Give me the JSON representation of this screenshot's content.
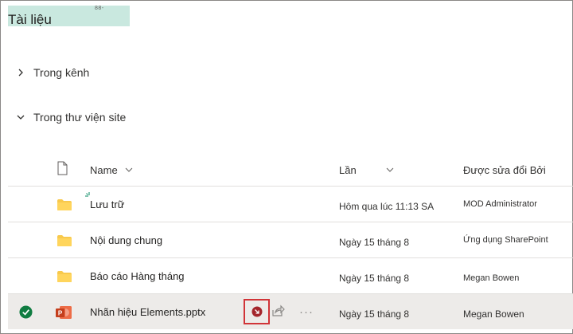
{
  "header": {
    "title": "Tài liệu",
    "badge": "88-"
  },
  "sections": [
    {
      "label": "Trong kênh",
      "expanded": false
    },
    {
      "label": "Trong thư viện site",
      "expanded": true
    }
  ],
  "columns": {
    "name": "Name",
    "modified": "Lần",
    "modified_by": "Được sửa đổi Bởi"
  },
  "rows": [
    {
      "type": "folder",
      "name": "Lưu trữ",
      "modified": "Hôm qua lúc 11:13 SA",
      "modified_by": "MOD Administrator",
      "icon": "folder-icon"
    },
    {
      "type": "folder",
      "name": "Nội dung chung",
      "modified": "Ngày 15 tháng 8",
      "modified_by": "Ứng dụng SharePoint",
      "icon": "folder-icon"
    },
    {
      "type": "folder",
      "name": "Báo cáo Hàng tháng",
      "modified": "Ngày 15 tháng 8",
      "modified_by": "Megan Bowen",
      "icon": "folder-icon"
    },
    {
      "type": "pptx",
      "name": "Nhãn hiệu Elements.pptx",
      "modified": "Ngày 15 tháng 8",
      "modified_by": "Megan Bowen",
      "icon": "powerpoint-icon",
      "selected": true,
      "more": "···"
    }
  ],
  "colors": {
    "accent_highlight": "#c9e8df",
    "folder": "#f8c94c",
    "check": "#107c41",
    "powerpoint": "#c43e1c",
    "action_border": "#d13438"
  }
}
